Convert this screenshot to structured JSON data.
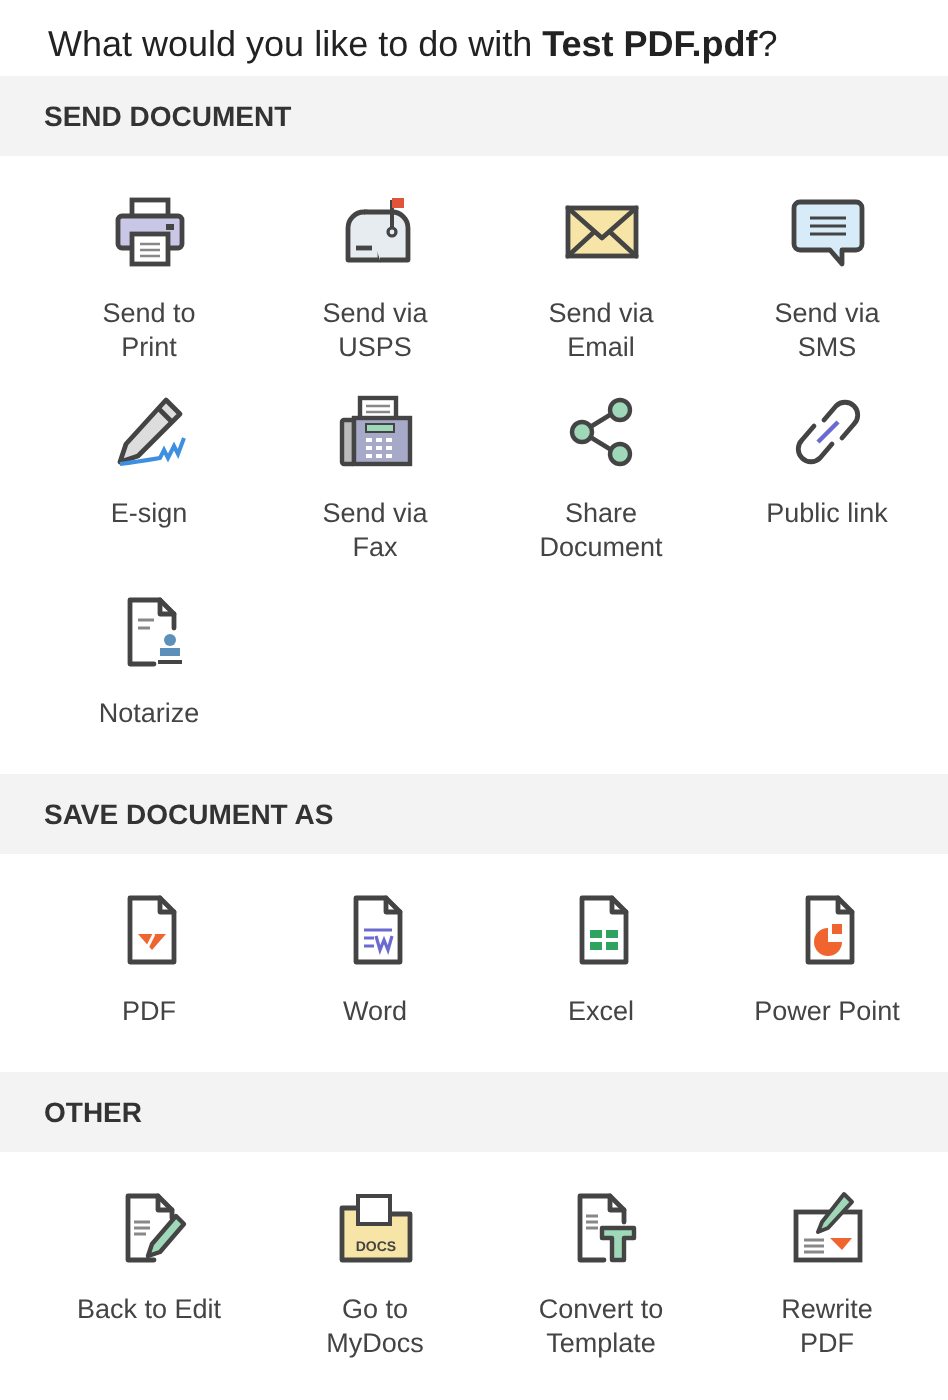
{
  "title": "What would you like to do with **Test PDF.pdf**?",
  "sections": [
    {
      "heading": "SEND DOCUMENT",
      "actions": [
        {
          "label": "Send to\nPrint",
          "kind": "printer"
        },
        {
          "label": "Send via\nUSPS",
          "kind": "mailbox"
        },
        {
          "label": "Send via\nEmail",
          "kind": "envelope"
        },
        {
          "label": "Send via\nSMS",
          "kind": "chat"
        },
        {
          "label": "E-sign",
          "kind": "pen"
        },
        {
          "label": "Send via\nFax",
          "kind": "fax"
        },
        {
          "label": "Share\nDocument",
          "kind": "share"
        },
        {
          "label": "Public link",
          "kind": "link"
        },
        {
          "label": "Notarize",
          "kind": "notary"
        }
      ]
    },
    {
      "heading": "SAVE DOCUMENT AS",
      "actions": [
        {
          "label": "PDF",
          "kind": "pdf"
        },
        {
          "label": "Word",
          "kind": "word"
        },
        {
          "label": "Excel",
          "kind": "excel"
        },
        {
          "label": "Power Point",
          "kind": "ppt"
        }
      ]
    },
    {
      "heading": "OTHER",
      "actions": [
        {
          "label": "Back to Edit",
          "kind": "edit"
        },
        {
          "label": "Go to\nMyDocs",
          "kind": "folder",
          "badge": "DOCS"
        },
        {
          "label": "Convert to\nTemplate",
          "kind": "template"
        },
        {
          "label": "Rewrite\nPDF",
          "kind": "rewrite"
        }
      ]
    }
  ]
}
